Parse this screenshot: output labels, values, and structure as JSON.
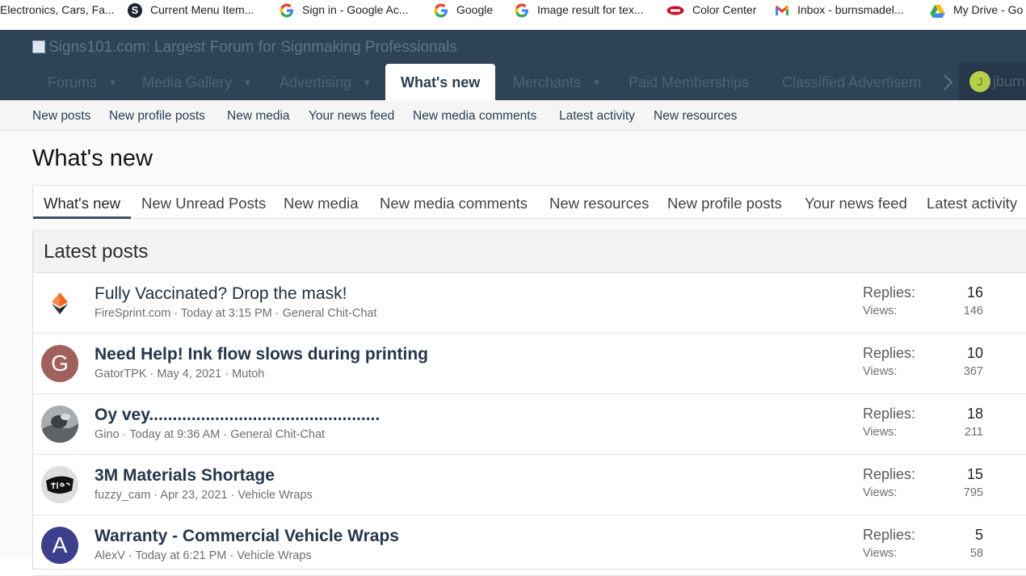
{
  "bookmarks": [
    {
      "label": "Electronics, Cars, Fa...",
      "icon": "none"
    },
    {
      "label": "Current Menu Item...",
      "icon": "s-logo-icon"
    },
    {
      "label": "Sign in - Google Ac...",
      "icon": "google-icon"
    },
    {
      "label": "Google",
      "icon": "google-icon"
    },
    {
      "label": "Image result for tex...",
      "icon": "google-icon"
    },
    {
      "label": "Color Center",
      "icon": "color-center-icon"
    },
    {
      "label": "Inbox - burnsmadel...",
      "icon": "gmail-icon"
    },
    {
      "label": "My Drive - Go",
      "icon": "google-drive-icon"
    }
  ],
  "header": {
    "logo_alt": "Signs101.com: Largest Forum for Signmaking Professionals",
    "nav": [
      {
        "label": "Forums"
      },
      {
        "label": "Media Gallery"
      },
      {
        "label": "Advertising"
      },
      {
        "label": "What's new"
      },
      {
        "label": "Merchants"
      },
      {
        "label": "Paid Memberships"
      },
      {
        "label": "Classified Advertisem"
      }
    ],
    "user_initial": "J",
    "user_name": "jburn"
  },
  "subnav": [
    "New posts",
    "New profile posts",
    "New media",
    "Your news feed",
    "New media comments",
    "Latest activity",
    "New resources"
  ],
  "page_title": "What's new",
  "tabs": [
    "What's new",
    "New Unread Posts",
    "New media",
    "New media comments",
    "New resources",
    "New profile posts",
    "Your news feed",
    "Latest activity"
  ],
  "latest": {
    "title": "Latest posts",
    "replies_label": "Replies:",
    "views_label": "Views:",
    "threads": [
      {
        "title": "Fully Vaccinated? Drop the mask!",
        "author": "FireSprint.com",
        "date": "Today at 3:15 PM",
        "forum": "General Chit-Chat",
        "replies": "16",
        "views": "146",
        "avatar": "firesprint-logo-icon"
      },
      {
        "title": "Need Help! Ink flow slows during printing",
        "author": "GatorTPK",
        "date": "May 4, 2021",
        "forum": "Mutoh",
        "replies": "10",
        "views": "367",
        "avatar_letter": "G",
        "avatar_color": "#a0605c"
      },
      {
        "title": "Oy vey.................................................",
        "author": "Gino",
        "date": "Today at 9:36 AM",
        "forum": "General Chit-Chat",
        "replies": "18",
        "views": "211",
        "avatar": "photo-avatar"
      },
      {
        "title": "3M Materials Shortage",
        "author": "fuzzy_cam",
        "date": "Apr 23, 2021",
        "forum": "Vehicle Wraps",
        "replies": "15",
        "views": "795",
        "avatar": "fleet-ink-logo"
      },
      {
        "title": "Warranty - Commercial Vehicle Wraps",
        "author": "AlexV",
        "date": "Today at 6:21 PM",
        "forum": "Vehicle Wraps",
        "replies": "5",
        "views": "58",
        "avatar_letter": "A",
        "avatar_color": "#3b3f8c"
      }
    ]
  }
}
